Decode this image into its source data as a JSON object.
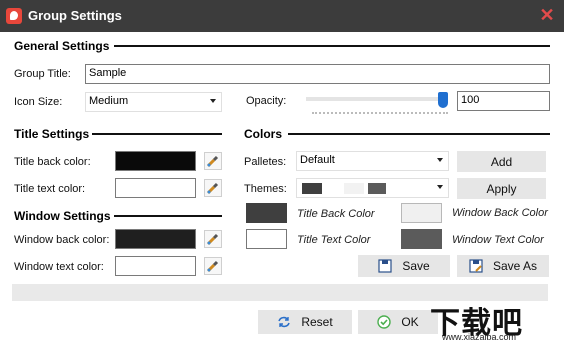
{
  "window": {
    "title": "Group Settings"
  },
  "general": {
    "section_title": "General Settings",
    "group_title_label": "Group Title:",
    "group_title_value": "Sample",
    "icon_size_label": "Icon Size:",
    "icon_size_value": "Medium",
    "opacity_label": "Opacity:",
    "opacity_value": "100"
  },
  "title_settings": {
    "section_title": "Title Settings",
    "back_color_label": "Title back color:",
    "text_color_label": "Title text color:"
  },
  "window_settings": {
    "section_title": "Window Settings",
    "back_color_label": "Window back color:",
    "text_color_label": "Window text color:"
  },
  "colors": {
    "section_title": "Colors",
    "palletes_label": "Palletes:",
    "palletes_value": "Default",
    "themes_label": "Themes:",
    "add_label": "Add",
    "apply_label": "Apply",
    "title_back_color_label": "Title Back Color",
    "window_back_color_label": "Window Back Color",
    "title_text_color_label": "Title Text Color",
    "window_text_color_label": "Window Text Color",
    "save_label": "Save",
    "save_as_label": "Save As"
  },
  "footer": {
    "reset_label": "Reset",
    "ok_label": "OK"
  },
  "watermark": {
    "main": "下载吧",
    "sub": "www.xiazaiba.com"
  },
  "palette": {
    "title_back": "#0a0a0a",
    "title_text": "#ffffff",
    "window_back": "#1f1f1f",
    "window_text": "#ffffff",
    "sample_title_back": "#3f3f3f",
    "sample_window_back": "#f0f0f0",
    "sample_title_text": "#ffffff",
    "sample_window_text": "#5b5b5b",
    "accent": "#1f6fd0"
  },
  "opacity_slider": {
    "value": 100,
    "max": 100
  }
}
